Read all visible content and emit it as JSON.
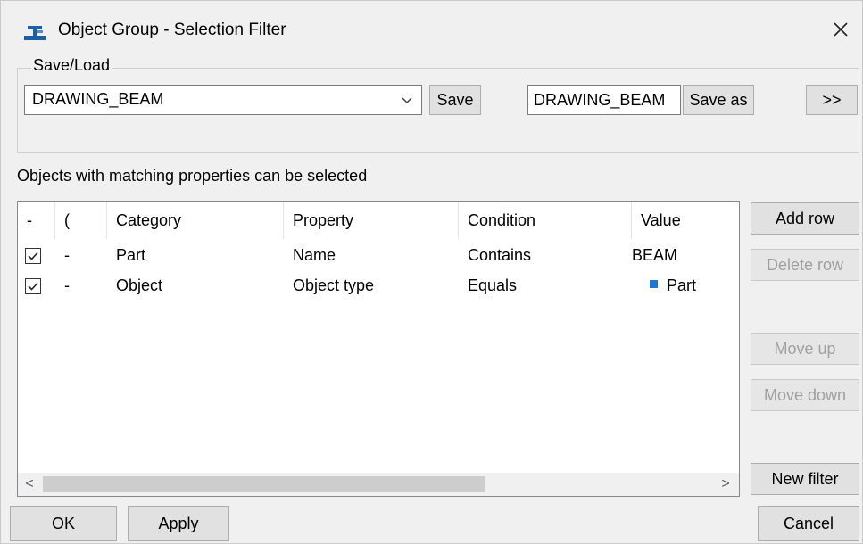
{
  "window": {
    "title": "Object Group - Selection Filter",
    "close_glyph": "✕"
  },
  "save_load": {
    "legend": "Save/Load",
    "combo_value": "DRAWING_BEAM",
    "save_label": "Save",
    "save_as_value": "DRAWING_BEAM",
    "save_as_label": "Save as",
    "expand_label": ">>"
  },
  "filter": {
    "description": "Objects with matching properties can be selected",
    "columns": [
      "-",
      "(",
      "Category",
      "Property",
      "Condition",
      "Value"
    ],
    "rows": [
      {
        "checked": true,
        "paren": "-",
        "category": "Part",
        "property": "Name",
        "condition": "Contains",
        "value": "BEAM",
        "value_icon": ""
      },
      {
        "checked": true,
        "paren": "-",
        "category": "Object",
        "property": "Object type",
        "condition": "Equals",
        "value": "Part",
        "value_icon": "blue-square-icon"
      }
    ],
    "scroll_left": "<",
    "scroll_right": ">"
  },
  "side_buttons": {
    "add_row": "Add row",
    "delete_row": "Delete row",
    "move_up": "Move up",
    "move_down": "Move down",
    "new_filter": "New filter"
  },
  "footer": {
    "ok": "OK",
    "apply": "Apply",
    "cancel": "Cancel"
  },
  "colors": {
    "window_bg": "#f0f0f0",
    "button_bg": "#e1e1e1",
    "disabled_text": "#a0a0a0",
    "value_icon": "#1e78d0"
  }
}
